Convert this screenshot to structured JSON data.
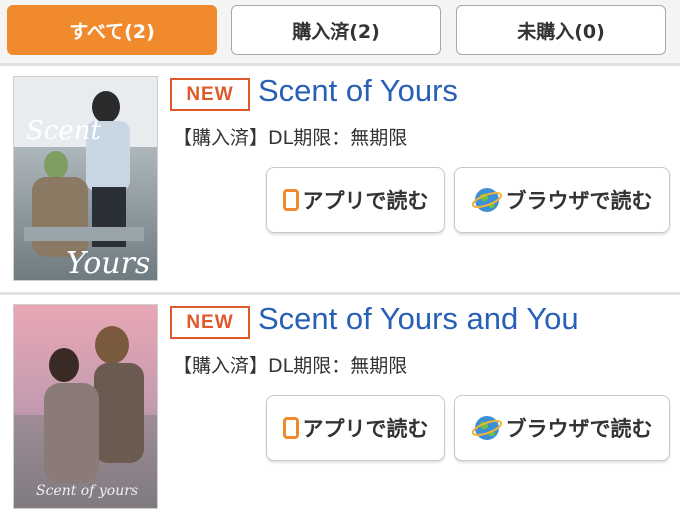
{
  "tabs": [
    {
      "label": "すべて(2)",
      "active": true
    },
    {
      "label": "購入済(2)",
      "active": false
    },
    {
      "label": "未購入(0)",
      "active": false
    }
  ],
  "items": [
    {
      "badge": "NEW",
      "title": "Scent of Yours",
      "status": "【購入済】DL期限：無期限",
      "app_button": "アプリで読む",
      "browser_button": "ブラウザで読む",
      "cover_text_top": "Scent",
      "cover_text_bottom": "Yours"
    },
    {
      "badge": "NEW",
      "title": "Scent of Yours and You",
      "status": "【購入済】DL期限：無期限",
      "app_button": "アプリで読む",
      "browser_button": "ブラウザで読む",
      "cover_text_bottom": "Scent of yours"
    }
  ],
  "icons": {
    "app": "app-icon",
    "browser": "globe-icon"
  },
  "colors": {
    "accent": "#f08a2c",
    "title": "#2860b5",
    "badge": "#e0592a"
  }
}
